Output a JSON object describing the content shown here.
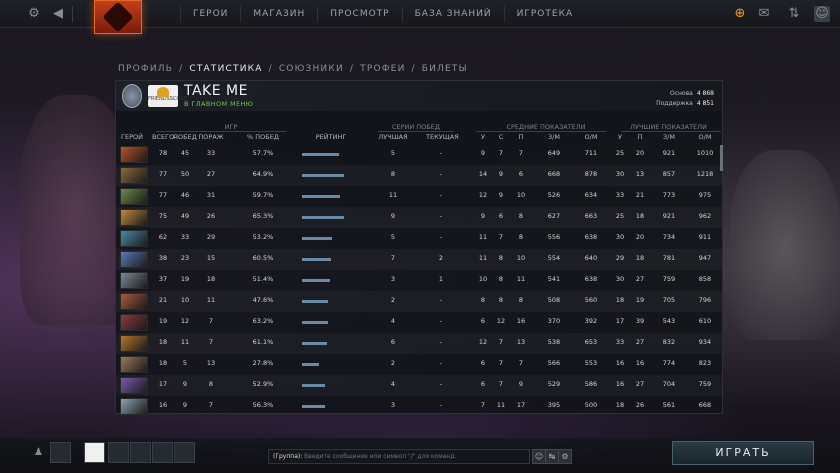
{
  "nav": {
    "items": [
      "ГЕРОИ",
      "МАГАЗИН",
      "ПРОСМОТР",
      "БАЗА ЗНАНИЙ",
      "ИГРОТЕКА"
    ]
  },
  "breadcrumb": {
    "items": [
      {
        "label": "ПРОФИЛЬ",
        "active": false
      },
      {
        "label": "СТАТИСТИКА",
        "active": true
      },
      {
        "label": "СОЮЗНИКИ",
        "active": false
      },
      {
        "label": "ТРОФЕИ",
        "active": false
      },
      {
        "label": "БИЛЕТЫ",
        "active": false
      }
    ],
    "separator": "/"
  },
  "profile": {
    "name": "TAKE ME",
    "status": "В ГЛАВНОМ МЕНЮ",
    "guild_tag": "FRIENDSSCORE",
    "score_base_label": "Основа",
    "score_base": "4 868",
    "score_support_label": "Поддержка",
    "score_support": "4 851"
  },
  "groups": {
    "games": "ИГР",
    "streaks": "СЕРИИ ПОБЕД",
    "avg": "СРЕДНИЕ ПОКАЗАТЕЛИ",
    "best": "ЛУЧШИЕ ПОКАЗАТЕЛИ"
  },
  "columns": {
    "hero": "ГЕРОЙ",
    "total": "ВСЕГО",
    "wins": "ПОБЕД",
    "losses": "ПОРАЖ",
    "winrate": "% ПОБЕД",
    "rating": "РЕЙТИНГ",
    "best": "ЛУЧШАЯ",
    "current": "ТЕКУЩАЯ",
    "k": "У",
    "d": "С",
    "a": "П",
    "gpm": "З/М",
    "xpm": "О/М",
    "bk": "У",
    "ba": "П",
    "bgpm": "З/М",
    "bxpm": "О/М",
    "sort_indicator": "⌄"
  },
  "rows": [
    {
      "total": "78",
      "wins": "45",
      "losses": "33",
      "winrate": "57.7%",
      "rating": 0.58,
      "best": "5",
      "current": "-",
      "k": "9",
      "d": "7",
      "a": "7",
      "gpm": "649",
      "xpm": "711",
      "bk": "25",
      "ba": "20",
      "bgpm": "921",
      "bxpm": "1010",
      "color": "#b5532a"
    },
    {
      "total": "77",
      "wins": "50",
      "losses": "27",
      "winrate": "64.9%",
      "rating": 0.65,
      "best": "8",
      "current": "-",
      "k": "14",
      "d": "9",
      "a": "6",
      "gpm": "668",
      "xpm": "878",
      "bk": "30",
      "ba": "13",
      "bgpm": "857",
      "bxpm": "1218",
      "color": "#8a6a3a"
    },
    {
      "total": "77",
      "wins": "46",
      "losses": "31",
      "winrate": "59.7%",
      "rating": 0.6,
      "best": "11",
      "current": "-",
      "k": "12",
      "d": "9",
      "a": "10",
      "gpm": "526",
      "xpm": "634",
      "bk": "33",
      "ba": "21",
      "bgpm": "773",
      "bxpm": "975",
      "color": "#6b8a4a"
    },
    {
      "total": "75",
      "wins": "49",
      "losses": "26",
      "winrate": "65.3%",
      "rating": 0.66,
      "best": "9",
      "current": "-",
      "k": "9",
      "d": "6",
      "a": "8",
      "gpm": "627",
      "xpm": "663",
      "bk": "25",
      "ba": "18",
      "bgpm": "921",
      "bxpm": "962",
      "color": "#c08a3a"
    },
    {
      "total": "62",
      "wins": "33",
      "losses": "29",
      "winrate": "53.2%",
      "rating": 0.47,
      "best": "5",
      "current": "-",
      "k": "11",
      "d": "7",
      "a": "8",
      "gpm": "556",
      "xpm": "638",
      "bk": "30",
      "ba": "20",
      "bgpm": "734",
      "bxpm": "911",
      "color": "#4a8aa8"
    },
    {
      "total": "38",
      "wins": "23",
      "losses": "15",
      "winrate": "60.5%",
      "rating": 0.45,
      "best": "7",
      "current": "2",
      "k": "11",
      "d": "8",
      "a": "10",
      "gpm": "554",
      "xpm": "640",
      "bk": "29",
      "ba": "18",
      "bgpm": "781",
      "bxpm": "947",
      "color": "#5a7ab8"
    },
    {
      "total": "37",
      "wins": "19",
      "losses": "18",
      "winrate": "51.4%",
      "rating": 0.43,
      "best": "3",
      "current": "1",
      "k": "10",
      "d": "8",
      "a": "11",
      "gpm": "541",
      "xpm": "638",
      "bk": "30",
      "ba": "27",
      "bgpm": "759",
      "bxpm": "858",
      "color": "#7a8a9a"
    },
    {
      "total": "21",
      "wins": "10",
      "losses": "11",
      "winrate": "47.6%",
      "rating": 0.4,
      "best": "2",
      "current": "-",
      "k": "8",
      "d": "8",
      "a": "8",
      "gpm": "508",
      "xpm": "560",
      "bk": "18",
      "ba": "19",
      "bgpm": "705",
      "bxpm": "796",
      "color": "#a85a3a"
    },
    {
      "total": "19",
      "wins": "12",
      "losses": "7",
      "winrate": "63.2%",
      "rating": 0.41,
      "best": "4",
      "current": "-",
      "k": "6",
      "d": "12",
      "a": "16",
      "gpm": "370",
      "xpm": "392",
      "bk": "17",
      "ba": "39",
      "bgpm": "543",
      "bxpm": "610",
      "color": "#8a3a3a"
    },
    {
      "total": "18",
      "wins": "11",
      "losses": "7",
      "winrate": "61.1%",
      "rating": 0.39,
      "best": "6",
      "current": "-",
      "k": "12",
      "d": "7",
      "a": "13",
      "gpm": "538",
      "xpm": "653",
      "bk": "33",
      "ba": "27",
      "bgpm": "832",
      "bxpm": "934",
      "color": "#b8762a"
    },
    {
      "total": "18",
      "wins": "5",
      "losses": "13",
      "winrate": "27.8%",
      "rating": 0.27,
      "best": "2",
      "current": "-",
      "k": "6",
      "d": "7",
      "a": "7",
      "gpm": "566",
      "xpm": "553",
      "bk": "16",
      "ba": "16",
      "bgpm": "774",
      "bxpm": "823",
      "color": "#9a7a5a"
    },
    {
      "total": "17",
      "wins": "9",
      "losses": "8",
      "winrate": "52.9%",
      "rating": 0.36,
      "best": "4",
      "current": "-",
      "k": "6",
      "d": "7",
      "a": "9",
      "gpm": "529",
      "xpm": "586",
      "bk": "16",
      "ba": "27",
      "bgpm": "704",
      "bxpm": "759",
      "color": "#7a5aa8"
    },
    {
      "total": "16",
      "wins": "9",
      "losses": "7",
      "winrate": "56.3%",
      "rating": 0.36,
      "best": "3",
      "current": "-",
      "k": "7",
      "d": "11",
      "a": "17",
      "gpm": "395",
      "xpm": "500",
      "bk": "18",
      "ba": "26",
      "bgpm": "561",
      "bxpm": "668",
      "color": "#8aa0b0"
    }
  ],
  "chat": {
    "prefix": "(Группа):",
    "placeholder": "Введите сообщение или символ \"/\" для команд."
  },
  "play_button": "ИГРАТЬ",
  "accent_color": "#7fc24a"
}
